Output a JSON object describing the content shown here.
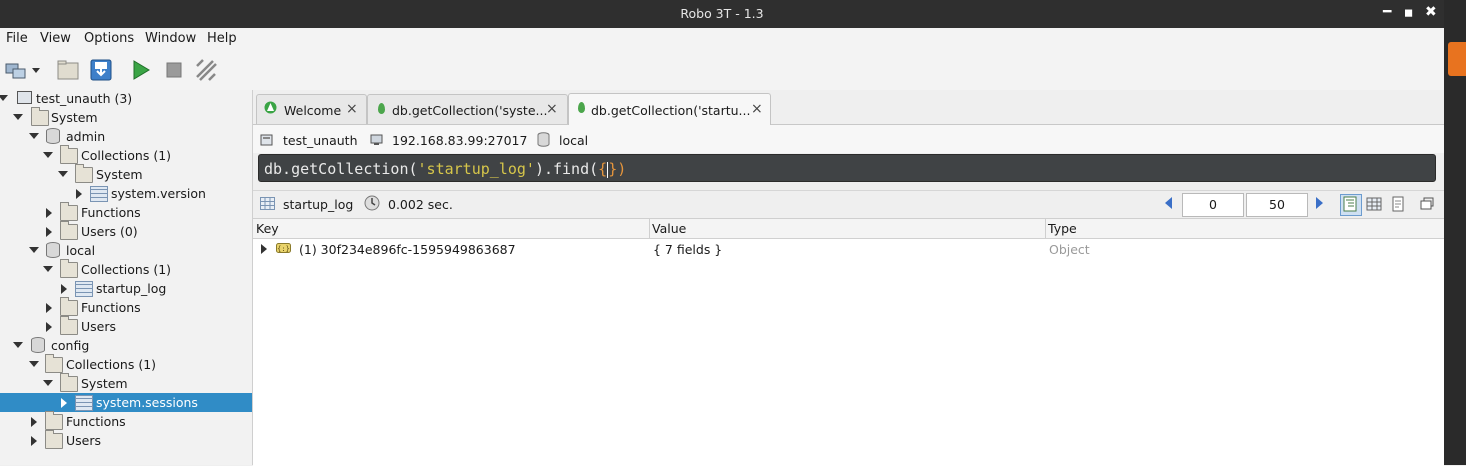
{
  "window": {
    "title": "Robo 3T - 1.3",
    "minimize": "━",
    "maximize": "◼",
    "close": "✖"
  },
  "menu": [
    "File",
    "View",
    "Options",
    "Window",
    "Help"
  ],
  "tree": {
    "root": "test_unauth (3)",
    "system": "System",
    "admin": "admin",
    "admin_collections": "Collections (1)",
    "admin_coll_system": "System",
    "admin_sysversion": "system.version",
    "admin_functions": "Functions",
    "admin_users": "Users (0)",
    "local": "local",
    "local_collections": "Collections (1)",
    "local_startup_log": "startup_log",
    "local_functions": "Functions",
    "local_users": "Users",
    "config": "config",
    "config_collections": "Collections (1)",
    "config_coll_system": "System",
    "config_sessions": "system.sessions",
    "config_functions": "Functions",
    "config_users": "Users"
  },
  "tabs": [
    {
      "label": "Welcome"
    },
    {
      "label": "db.getCollection('syste..."
    },
    {
      "label": "db.getCollection('startu..."
    }
  ],
  "connection": {
    "server": "test_unauth",
    "address": "192.168.83.99:27017",
    "database": "local"
  },
  "query": {
    "prefix": "db.getCollection(",
    "arg": "'startup_log'",
    "mid": ").find(",
    "open": "{",
    "close": "})"
  },
  "results": {
    "collection": "startup_log",
    "time": "0.002 sec.",
    "skip": "0",
    "limit": "50",
    "columns": [
      "Key",
      "Value",
      "Type"
    ],
    "rows": [
      {
        "key": "(1) 30f234e896fc-1595949863687",
        "value": "{ 7 fields }",
        "type": "Object"
      }
    ]
  },
  "colors": {
    "selection": "#308cc6",
    "accent": "#e8731f"
  }
}
